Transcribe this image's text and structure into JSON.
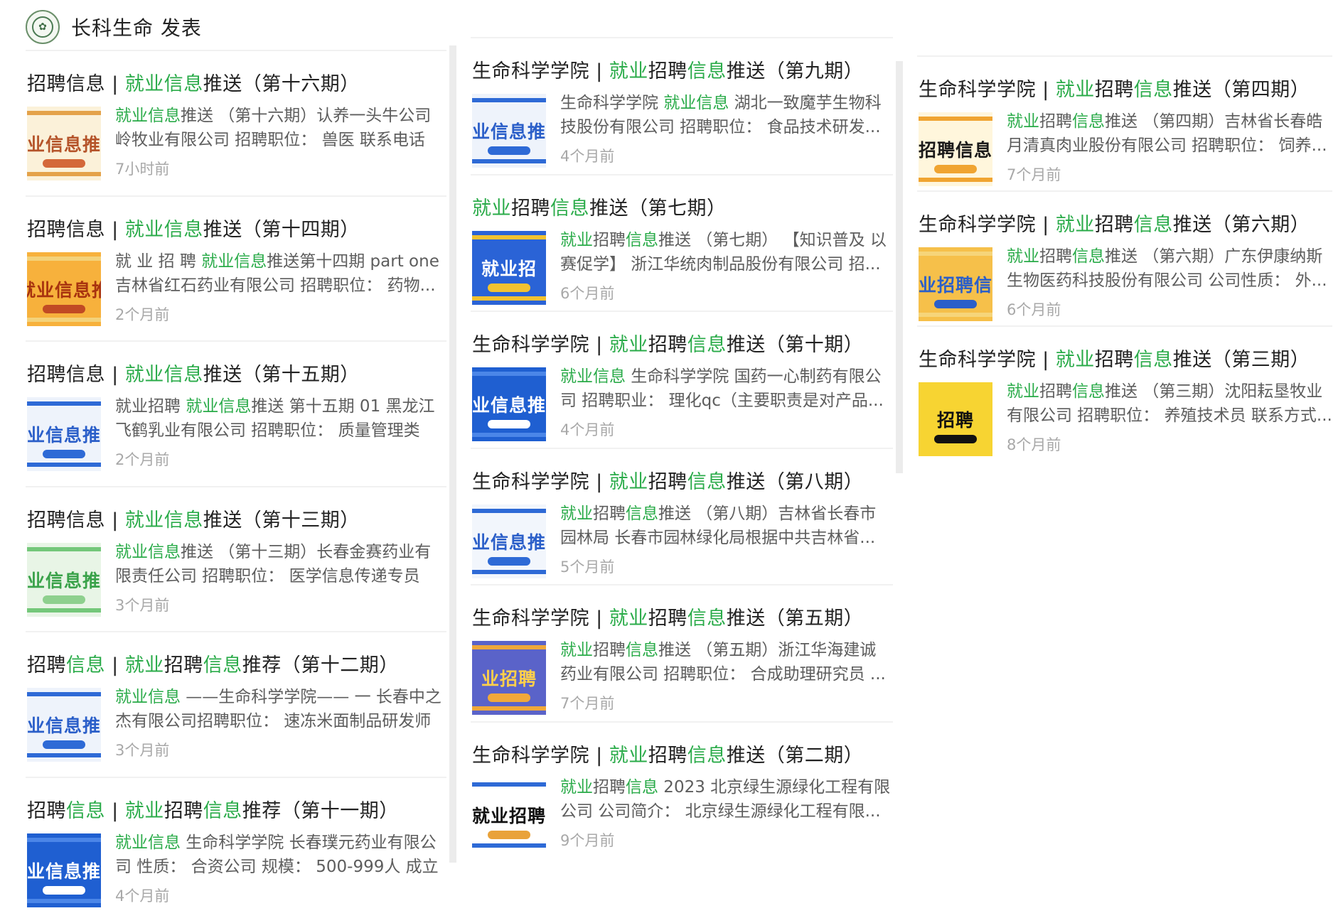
{
  "header": {
    "logo_icon": "university-seal-icon",
    "title": "长科生命 发表"
  },
  "colors": {
    "accent_green": "#2aab49",
    "text_gray": "#5d5d5d",
    "time_gray": "#a8a8a8"
  },
  "columns": [
    {
      "articles": [
        {
          "title": [
            {
              "t": "招聘信息 | "
            },
            {
              "t": "就业信息",
              "g": true
            },
            {
              "t": "推送（第十六期）"
            }
          ],
          "thumb": {
            "text": "业信息推",
            "icon": "recruitment-cover-thumbnail",
            "style": "cream"
          },
          "desc1": [
            {
              "t": "就业信息",
              "g": true
            },
            {
              "t": "推送 （第十六期）认养一头牛公司"
            }
          ],
          "desc2": [
            {
              "t": "岭牧业有限公司 招聘职位： 兽医 联系电话"
            }
          ],
          "time": "7小时前"
        },
        {
          "title": [
            {
              "t": "招聘信息 | "
            },
            {
              "t": "就业信息",
              "g": true
            },
            {
              "t": "推送（第十四期）"
            }
          ],
          "thumb": {
            "text": "就业信息推",
            "icon": "recruitment-cover-thumbnail",
            "style": "orange"
          },
          "desc1": [
            {
              "t": "就 业 招 聘 "
            },
            {
              "t": "就业信息",
              "g": true
            },
            {
              "t": "推送第十四期 part one"
            }
          ],
          "desc2": [
            {
              "t": "吉林省红石药业有限公司 招聘职位： 药物..."
            }
          ],
          "time": "2个月前"
        },
        {
          "title": [
            {
              "t": "招聘信息 | "
            },
            {
              "t": "就业信息",
              "g": true
            },
            {
              "t": "推送（第十五期）"
            }
          ],
          "thumb": {
            "text": "业信息推",
            "icon": "recruitment-cover-thumbnail",
            "style": "blue"
          },
          "desc1": [
            {
              "t": "就业招聘 "
            },
            {
              "t": "就业信息",
              "g": true
            },
            {
              "t": "推送 第十五期 01 黑龙江"
            }
          ],
          "desc2": [
            {
              "t": "飞鹤乳业有限公司 招聘职位： 质量管理类"
            }
          ],
          "time": "2个月前"
        },
        {
          "title": [
            {
              "t": "招聘信息 | "
            },
            {
              "t": "就业信息",
              "g": true
            },
            {
              "t": "推送（第十三期）"
            }
          ],
          "thumb": {
            "text": "业信息推",
            "icon": "recruitment-cover-thumbnail",
            "style": "green"
          },
          "desc1": [
            {
              "t": "就业信息",
              "g": true
            },
            {
              "t": "推送 （第十三期）长春金赛药业有"
            }
          ],
          "desc2": [
            {
              "t": "限责任公司 招聘职位： 医学信息传递专员"
            }
          ],
          "time": "3个月前"
        },
        {
          "title": [
            {
              "t": "招聘"
            },
            {
              "t": "信息",
              "g": true
            },
            {
              "t": " | "
            },
            {
              "t": "就业",
              "g": true
            },
            {
              "t": "招聘"
            },
            {
              "t": "信息",
              "g": true
            },
            {
              "t": "推荐（第十二期）"
            }
          ],
          "thumb": {
            "text": "业信息推",
            "icon": "recruitment-cover-thumbnail",
            "style": "blue"
          },
          "desc1": [
            {
              "t": "就业信息",
              "g": true
            },
            {
              "t": " ——生命科学学院—— 一 长春中之"
            }
          ],
          "desc2": [
            {
              "t": "杰有限公司招聘职位： 速冻米面制品研发师"
            }
          ],
          "time": "3个月前"
        },
        {
          "title": [
            {
              "t": "招聘"
            },
            {
              "t": "信息",
              "g": true
            },
            {
              "t": " | "
            },
            {
              "t": "就业",
              "g": true
            },
            {
              "t": "招聘"
            },
            {
              "t": "信息",
              "g": true
            },
            {
              "t": "推荐（第十一期）"
            }
          ],
          "thumb": {
            "text": "业信息推",
            "icon": "recruitment-cover-thumbnail",
            "style": "deepblue"
          },
          "desc1": [
            {
              "t": "就业信息",
              "g": true
            },
            {
              "t": " 生命科学学院 长春璞元药业有限公"
            }
          ],
          "desc2": [
            {
              "t": "司 性质： 合资公司 规模： 500-999人 成立"
            }
          ],
          "time": "4个月前"
        }
      ]
    },
    {
      "articles": [
        {
          "title": [
            {
              "t": "生命科学学院 | "
            },
            {
              "t": "就业",
              "g": true
            },
            {
              "t": "招聘"
            },
            {
              "t": "信息",
              "g": true
            },
            {
              "t": "推送（第九期）"
            }
          ],
          "thumb": {
            "text": "业信息推",
            "icon": "recruitment-cover-thumbnail",
            "style": "blue"
          },
          "desc1": [
            {
              "t": "生命科学学院 "
            },
            {
              "t": "就业信息",
              "g": true
            },
            {
              "t": " 湖北一致魔芋生物科"
            }
          ],
          "desc2": [
            {
              "t": "技股份有限公司 招聘职位： 食品技术研发..."
            }
          ],
          "time": "4个月前"
        },
        {
          "title": [
            {
              "t": "就业",
              "g": true
            },
            {
              "t": "招聘"
            },
            {
              "t": "信息",
              "g": true
            },
            {
              "t": "推送（第七期）"
            }
          ],
          "thumb": {
            "text": "就业招",
            "icon": "recruitment-cover-thumbnail",
            "style": "bluegold"
          },
          "desc1": [
            {
              "t": "就业",
              "g": true
            },
            {
              "t": "招聘"
            },
            {
              "t": "信息",
              "g": true
            },
            {
              "t": "推送 （第七期） 【知识普及 以"
            }
          ],
          "desc2": [
            {
              "t": "赛促学】 浙江华统肉制品股份有限公司 招..."
            }
          ],
          "time": "6个月前"
        },
        {
          "title": [
            {
              "t": "生命科学学院 | "
            },
            {
              "t": "就业",
              "g": true
            },
            {
              "t": "招聘"
            },
            {
              "t": "信息",
              "g": true
            },
            {
              "t": "推送（第十期）"
            }
          ],
          "thumb": {
            "text": "业信息推",
            "icon": "recruitment-cover-thumbnail",
            "style": "deepblue"
          },
          "desc1": [
            {
              "t": "就业信息",
              "g": true
            },
            {
              "t": " 生命科学学院 国药一心制药有限公"
            }
          ],
          "desc2": [
            {
              "t": "司 招聘职业： 理化qc（主要职责是对产品..."
            }
          ],
          "time": "4个月前"
        },
        {
          "title": [
            {
              "t": "生命科学学院 | "
            },
            {
              "t": "就业",
              "g": true
            },
            {
              "t": "招聘"
            },
            {
              "t": "信息",
              "g": true
            },
            {
              "t": "推送（第八期）"
            }
          ],
          "thumb": {
            "text": "业信息推",
            "icon": "recruitment-cover-thumbnail",
            "style": "lightblue"
          },
          "desc1": [
            {
              "t": "就业",
              "g": true
            },
            {
              "t": "招聘"
            },
            {
              "t": "信息",
              "g": true
            },
            {
              "t": "推送 （第八期）吉林省长春市"
            }
          ],
          "desc2": [
            {
              "t": "园林局 长春市园林绿化局根据中共吉林省..."
            }
          ],
          "time": "5个月前"
        },
        {
          "title": [
            {
              "t": "生命科学学院 | "
            },
            {
              "t": "就业",
              "g": true
            },
            {
              "t": "招聘"
            },
            {
              "t": "信息",
              "g": true
            },
            {
              "t": "推送（第五期）"
            }
          ],
          "thumb": {
            "text": "业招聘",
            "icon": "recruitment-cover-thumbnail",
            "style": "purple"
          },
          "desc1": [
            {
              "t": "就业",
              "g": true
            },
            {
              "t": "招聘"
            },
            {
              "t": "信息",
              "g": true
            },
            {
              "t": "推送 （第五期）浙江华海建诚"
            }
          ],
          "desc2": [
            {
              "t": "药业有限公司 招聘职位： 合成助理研究员 ..."
            }
          ],
          "time": "7个月前"
        },
        {
          "title": [
            {
              "t": "生命科学学院 | "
            },
            {
              "t": "就业",
              "g": true
            },
            {
              "t": "招聘"
            },
            {
              "t": "信息",
              "g": true
            },
            {
              "t": "推送（第二期）"
            }
          ],
          "thumb": {
            "text": "就业招聘",
            "icon": "recruitment-cover-thumbnail",
            "style": "whiteblue"
          },
          "desc1": [
            {
              "t": "就业",
              "g": true
            },
            {
              "t": "招聘"
            },
            {
              "t": "信息",
              "g": true
            },
            {
              "t": " 2023 北京绿生源绿化工程有限"
            }
          ],
          "desc2": [
            {
              "t": "公司 公司简介： 北京绿生源绿化工程有限..."
            }
          ],
          "time": "9个月前"
        }
      ]
    },
    {
      "articles": [
        {
          "title": [
            {
              "t": "生命科学学院 | "
            },
            {
              "t": "就业",
              "g": true
            },
            {
              "t": "招聘"
            },
            {
              "t": "信息",
              "g": true
            },
            {
              "t": "推送（第四期）"
            }
          ],
          "thumb": {
            "text": "招聘信息",
            "icon": "recruitment-cover-thumbnail",
            "style": "goldstripe"
          },
          "desc1": [
            {
              "t": "就业",
              "g": true
            },
            {
              "t": "招聘"
            },
            {
              "t": "信息",
              "g": true
            },
            {
              "t": "推送 （第四期）吉林省长春皓"
            }
          ],
          "desc2": [
            {
              "t": "月清真肉业股份有限公司 招聘职位： 饲养..."
            }
          ],
          "time": "7个月前"
        },
        {
          "title": [
            {
              "t": "生命科学学院 | "
            },
            {
              "t": "就业",
              "g": true
            },
            {
              "t": "招聘"
            },
            {
              "t": "信息",
              "g": true
            },
            {
              "t": "推送（第六期）"
            }
          ],
          "thumb": {
            "text": "业招聘信",
            "icon": "recruitment-cover-thumbnail",
            "style": "gold"
          },
          "desc1": [
            {
              "t": "就业",
              "g": true
            },
            {
              "t": "招聘"
            },
            {
              "t": "信息",
              "g": true
            },
            {
              "t": "推送 （第六期）广东伊康纳斯"
            }
          ],
          "desc2": [
            {
              "t": "生物医药科技股份有限公司 公司性质： 外..."
            }
          ],
          "time": "6个月前"
        },
        {
          "title": [
            {
              "t": "生命科学学院 | "
            },
            {
              "t": "就业",
              "g": true
            },
            {
              "t": "招聘"
            },
            {
              "t": "信息",
              "g": true
            },
            {
              "t": "推送（第三期）"
            }
          ],
          "thumb": {
            "text": "招聘",
            "icon": "recruitment-cover-thumbnail",
            "style": "yellowblack"
          },
          "desc1": [
            {
              "t": "就业",
              "g": true
            },
            {
              "t": "招聘"
            },
            {
              "t": "信息",
              "g": true
            },
            {
              "t": "推送 （第三期）沈阳耘垦牧业"
            }
          ],
          "desc2": [
            {
              "t": "有限公司 招聘职位： 养殖技术员 联系方式..."
            }
          ],
          "time": "8个月前"
        }
      ]
    }
  ]
}
